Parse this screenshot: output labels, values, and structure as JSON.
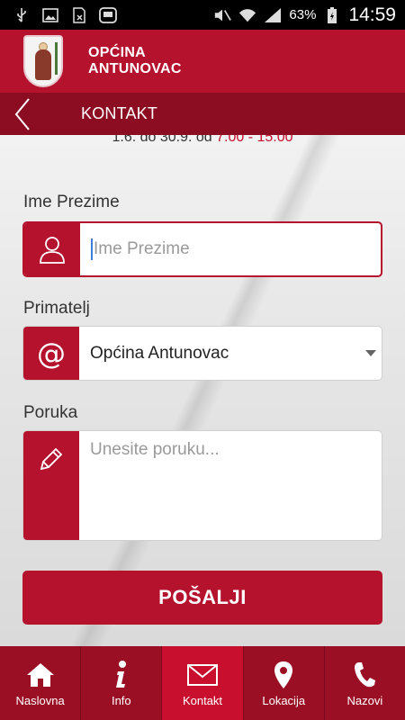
{
  "status_bar": {
    "battery": "63%",
    "time": "14:59",
    "icons": [
      "usb-icon",
      "image-icon",
      "sim-off-icon",
      "notification-icon",
      "mute-icon",
      "wifi-icon",
      "signal-icon",
      "battery-icon"
    ]
  },
  "header": {
    "title_line1": "OPĆINA",
    "title_line2": "ANTUNOVAC"
  },
  "section": {
    "title": "KONTAKT"
  },
  "hours": {
    "prefix": "1.6. do 30.9. od ",
    "range": "7.00 - 15.00"
  },
  "form": {
    "name": {
      "label": "Ime Prezime",
      "placeholder": "Ime Prezime"
    },
    "recipient": {
      "label": "Primatelj",
      "value": "Općina Antunovac"
    },
    "message": {
      "label": "Poruka",
      "placeholder": "Unesite poruku..."
    },
    "submit_label": "POŠALJI"
  },
  "nav": {
    "items": [
      {
        "label": "Naslovna",
        "icon": "home-icon"
      },
      {
        "label": "Info",
        "icon": "info-icon"
      },
      {
        "label": "Kontakt",
        "icon": "mail-icon",
        "active": true
      },
      {
        "label": "Lokacija",
        "icon": "location-pin-icon"
      },
      {
        "label": "Nazovi",
        "icon": "phone-icon"
      }
    ]
  },
  "colors": {
    "primary": "#b5122d",
    "dark": "#8c0d22",
    "active_nav": "#c8102e"
  }
}
